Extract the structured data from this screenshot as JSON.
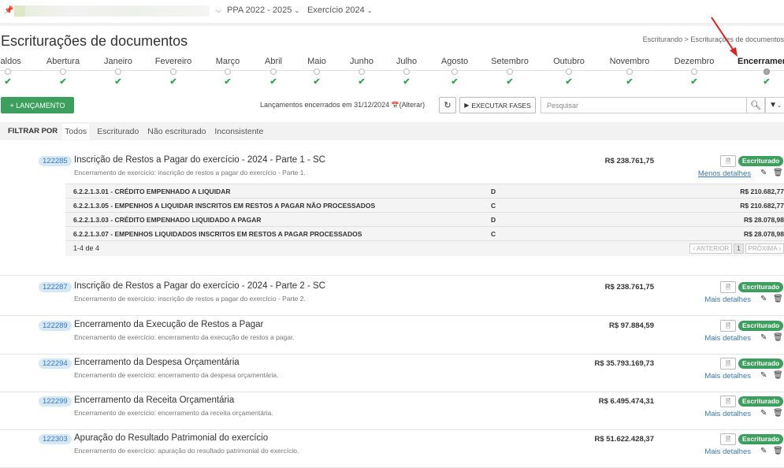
{
  "topbar": {
    "ppa": "PPA 2022 - 2025",
    "exercicio": "Exercício 2024"
  },
  "page": {
    "title": "Escriturações de documentos",
    "breadcrumb": "Escriturando > Escriturações de documentos"
  },
  "timeline": [
    {
      "label": "Saldos",
      "done": true
    },
    {
      "label": "Abertura",
      "done": true
    },
    {
      "label": "Janeiro",
      "done": true
    },
    {
      "label": "Fevereiro",
      "done": true
    },
    {
      "label": "Março",
      "done": true
    },
    {
      "label": "Abril",
      "done": true
    },
    {
      "label": "Maio",
      "done": true
    },
    {
      "label": "Junho",
      "done": true
    },
    {
      "label": "Julho",
      "done": true
    },
    {
      "label": "Agosto",
      "done": true
    },
    {
      "label": "Setembro",
      "done": true
    },
    {
      "label": "Outubro",
      "done": true
    },
    {
      "label": "Novembro",
      "done": true
    },
    {
      "label": "Dezembro",
      "done": true
    },
    {
      "label": "Encerramento",
      "done": true,
      "active": true
    }
  ],
  "toolbar": {
    "lancamento": "+ LANÇAMENTO",
    "encerrados": "Lançamentos encerrados em 31/12/2024",
    "alterar": "(Alterar)",
    "executar": "EXECUTAR FASES",
    "search_placeholder": "Pesquisar"
  },
  "filters": {
    "label": "FILTRAR POR",
    "options": [
      "Todos",
      "Escriturado",
      "Não escriturado",
      "Inconsistente"
    ]
  },
  "entries": [
    {
      "id": "122285",
      "title": "Inscrição de Restos a Pagar do exercício - 2024 - Parte 1 - SC",
      "desc": "Encerramento de exercício: inscrição de restos a pagar do exercício - Parte 1.",
      "value": "R$ 238.761,75",
      "status": "Escriturado",
      "details": "Menos detalhes"
    },
    {
      "id": "122287",
      "title": "Inscrição de Restos a Pagar do exercício - 2024 - Parte 2 - SC",
      "desc": "Encerramento de exercício: inscrição de restos a pagar do exercício - Parte 2.",
      "value": "R$ 238.761,75",
      "status": "Escriturado",
      "details": "Mais detalhes"
    },
    {
      "id": "122289",
      "title": "Encerramento da Execução de Restos a Pagar",
      "desc": "Encerramento de exercício: encerramento da execução de restos a pagar.",
      "value": "R$ 97.884,59",
      "status": "Escriturado",
      "details": "Mais detalhes"
    },
    {
      "id": "122294",
      "title": "Encerramento da Despesa Orçamentária",
      "desc": "Encerramento de exercício: encerramento da despesa orçamentária.",
      "value": "R$ 35.793.169,73",
      "status": "Escriturado",
      "details": "Mais detalhes"
    },
    {
      "id": "122299",
      "title": "Encerramento da Receita Orçamentária",
      "desc": "Encerramento de exercício: encerramento da receita orçamentária.",
      "value": "R$ 6.495.474,31",
      "status": "Escriturado",
      "details": "Mais detalhes"
    },
    {
      "id": "122303",
      "title": "Apuração do Resultado Patrimonial do exercício",
      "desc": "Encerramento de exercício: apuração do resultado patrimonial do exercício.",
      "value": "R$ 51.622.428,37",
      "status": "Escriturado",
      "details": "Mais detalhes"
    }
  ],
  "detail_rows": [
    {
      "account": "6.2.2.1.3.01 - CRÉDITO EMPENHADO A LIQUIDAR",
      "dc": "D",
      "amount": "R$ 210.682,77"
    },
    {
      "account": "6.2.2.1.3.05 - EMPENHOS A LIQUIDAR INSCRITOS EM RESTOS A PAGAR NÃO PROCESSADOS",
      "dc": "C",
      "amount": "R$ 210.682,77"
    },
    {
      "account": "6.2.2.1.3.03 - CRÉDITO EMPENHADO LIQUIDADO A PAGAR",
      "dc": "D",
      "amount": "R$ 28.078,98"
    },
    {
      "account": "6.2.2.1.3.07 - EMPENHOS LIQUIDADOS INSCRITOS EM RESTOS A PAGAR PROCESSADOS",
      "dc": "C",
      "amount": "R$ 28.078,98"
    }
  ],
  "detail_footer": {
    "count": "1-4 de 4",
    "prev": "‹ ANTERIOR",
    "page": "1",
    "next": "PRÓXIMA ›"
  },
  "colors": {
    "green": "#3d9f5d",
    "blue": "#3a79b8",
    "arrow": "#e0201b"
  }
}
